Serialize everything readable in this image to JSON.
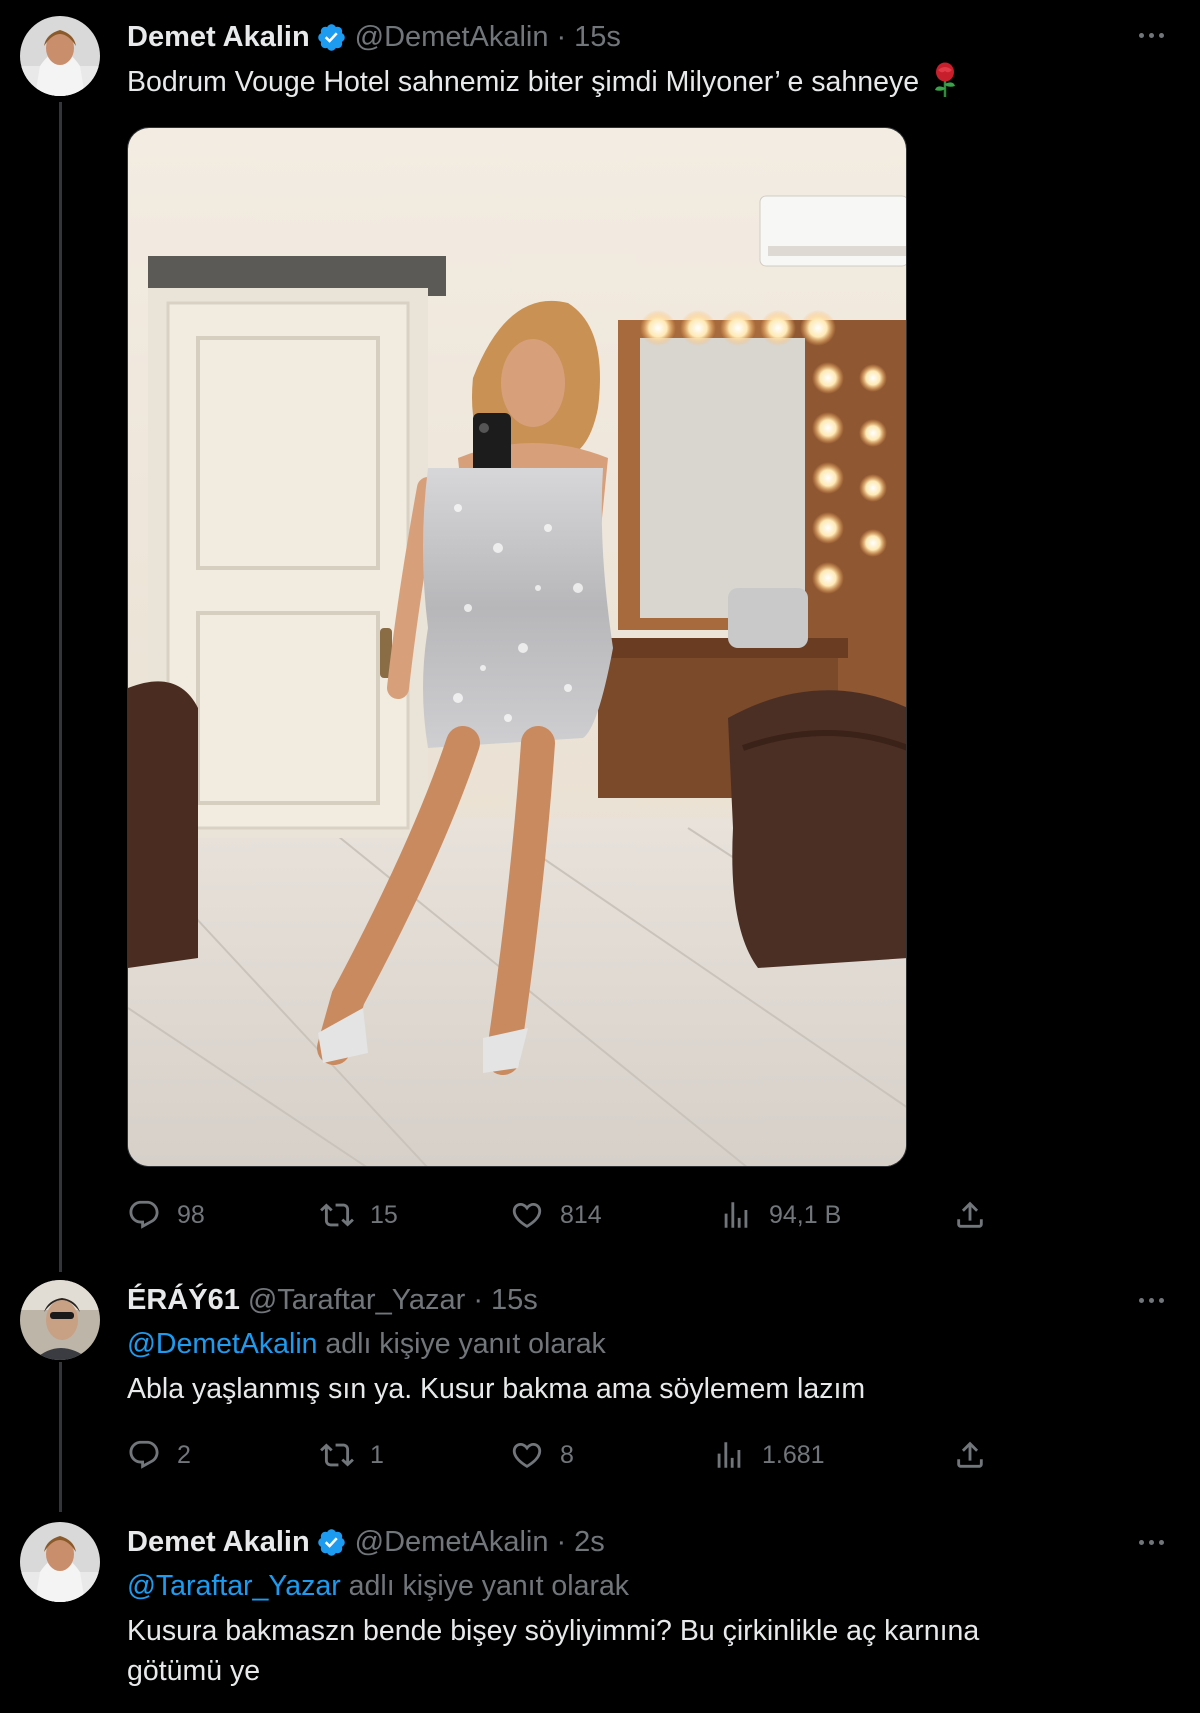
{
  "tweets": [
    {
      "name": "Demet Akalin",
      "handle": "@DemetAkalin",
      "time": "15s",
      "text": "Bodrum Vouge Hotel sahnemiz biter şimdi Milyoner’ e sahneye",
      "emoji": "rose-emoji",
      "verified": true,
      "stats": {
        "reply": "98",
        "retweet": "15",
        "like": "814",
        "views": "94,1 B"
      }
    },
    {
      "name": "ÉRÁÝ61",
      "handle": "@Taraftar_Yazar",
      "time": "15s",
      "replying_mention": "@DemetAkalin",
      "replying_suffix": " adlı kişiye yanıt olarak",
      "text": "Abla yaşlanmış sın ya. Kusur bakma ama söylemem lazım",
      "verified": false,
      "stats": {
        "reply": "2",
        "retweet": "1",
        "like": "8",
        "views": "1.681"
      }
    },
    {
      "name": "Demet Akalin",
      "handle": "@DemetAkalin",
      "time": "2s",
      "replying_mention": "@Taraftar_Yazar",
      "replying_suffix": " adlı kişiye yanıt olarak",
      "text_line1": "Kusura bakmaszn bende bişey söyliyimmi? Bu çirkinlikle aç karnına",
      "text_line2": "götümü ye",
      "verified": true
    }
  ],
  "separator": "·",
  "colors": {
    "background": "#000000",
    "text": "#e7e9ea",
    "secondary": "#71767b",
    "accent": "#1d9bf0",
    "verified": "#1d9bf0"
  },
  "icons": [
    "reply-icon",
    "retweet-icon",
    "like-icon",
    "views-icon",
    "share-icon",
    "more-icon",
    "verified-badge-icon"
  ]
}
